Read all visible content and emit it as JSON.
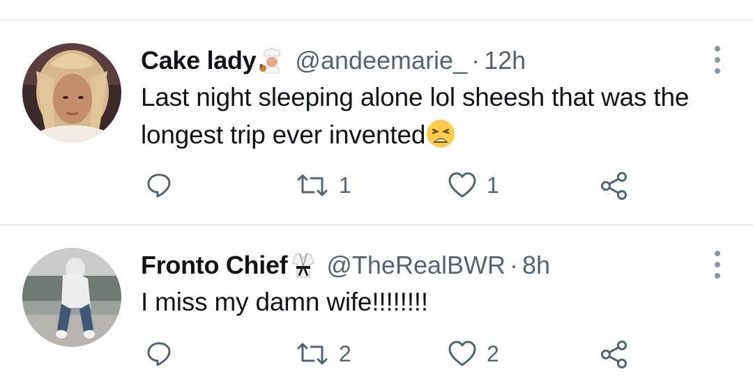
{
  "tweets": [
    {
      "display_name": "Cake lady",
      "badge_icon": "cook-emoji",
      "handle": "@andeemarie_",
      "separator": "·",
      "time": "12h",
      "text": "Last night sleeping alone lol sheesh that was the longest trip ever invented",
      "text_emoji": "weary-face-emoji",
      "replies": "",
      "retweets": "1",
      "likes": "1"
    },
    {
      "display_name": "Fronto Chief",
      "badge_icon": "martial-arts-uniform-emoji",
      "handle": "@TheRealBWR",
      "separator": "·",
      "time": "8h",
      "text": "I miss my damn wife!!!!!!!!",
      "replies": "",
      "retweets": "2",
      "likes": "2"
    }
  ],
  "colors": {
    "text": "#0f1419",
    "secondary": "#536471",
    "divider": "#e6ecf0"
  }
}
